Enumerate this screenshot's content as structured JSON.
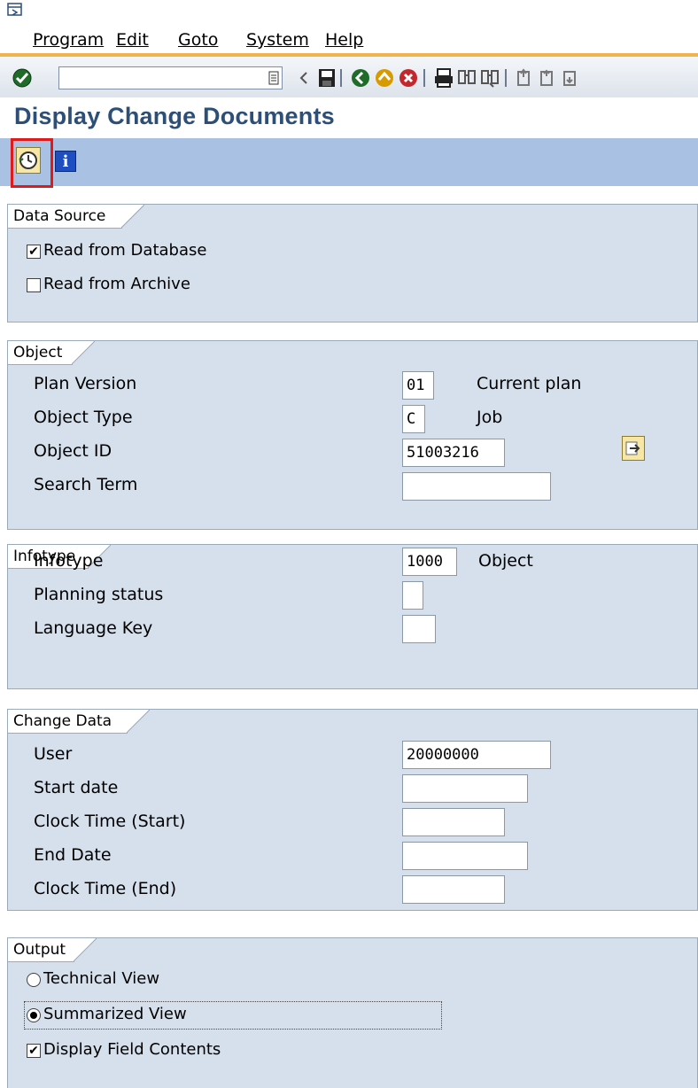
{
  "menu": {
    "items": [
      {
        "label": "Program"
      },
      {
        "label": "Edit"
      },
      {
        "label": "Goto"
      },
      {
        "label": "System"
      },
      {
        "label": "Help"
      }
    ]
  },
  "toolbar": {
    "command_value": "",
    "icons": [
      "enter-icon",
      "command-dropdown-icon",
      "back-triangle-icon",
      "save-icon",
      "back-icon",
      "exit-icon",
      "cancel-icon",
      "print-icon",
      "find-icon",
      "find-next-icon",
      "first-page-icon",
      "previous-page-icon",
      "next-page-icon"
    ]
  },
  "page": {
    "title": "Display Change Documents"
  },
  "app_toolbar": {
    "execute_icon": "execute-clock-icon",
    "info_icon": "information-icon",
    "info_glyph": "i"
  },
  "data_source": {
    "title": "Data Source",
    "options": [
      {
        "label": "Read from Database",
        "checked": true
      },
      {
        "label": "Read from Archive",
        "checked": false
      }
    ]
  },
  "object": {
    "title": "Object",
    "fields": [
      {
        "label": "Plan Version",
        "value": "01",
        "description": "Current plan"
      },
      {
        "label": "Object Type",
        "value": "C",
        "description": "Job"
      },
      {
        "label": "Object ID",
        "value": "51003216",
        "description": ""
      },
      {
        "label": "Search Term",
        "value": "",
        "description": ""
      }
    ]
  },
  "infotype": {
    "title": "Infotype",
    "fields": [
      {
        "label": "Infotype",
        "value": "1000",
        "description": "Object"
      },
      {
        "label": "Planning status",
        "value": "",
        "description": ""
      },
      {
        "label": "Language Key",
        "value": "",
        "description": ""
      }
    ]
  },
  "change_data": {
    "title": "Change Data",
    "fields": [
      {
        "label": "User",
        "value": "20000000"
      },
      {
        "label": "Start date",
        "value": ""
      },
      {
        "label": "Clock Time (Start)",
        "value": ""
      },
      {
        "label": "End Date",
        "value": ""
      },
      {
        "label": "Clock Time (End)",
        "value": ""
      }
    ]
  },
  "output": {
    "title": "Output",
    "views": [
      {
        "label": "Technical View",
        "selected": false
      },
      {
        "label": "Summarized View",
        "selected": true
      }
    ],
    "display_field_contents": {
      "label": "Display Field Contents",
      "checked": true
    }
  },
  "colors": {
    "title": "#2d4f77",
    "app_toolbar": "#a9c1e2",
    "group_box": "#d5e0ec",
    "menu_accent": "#f0b44c",
    "highlight": "#e01a1a"
  }
}
